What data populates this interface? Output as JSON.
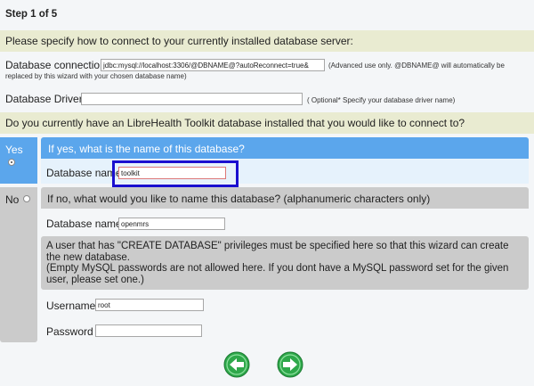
{
  "step": "Step 1 of 5",
  "intro": "Please specify how to connect to your currently installed database server:",
  "connection": {
    "label": "Database connection:",
    "value": "jdbc:mysql://localhost:3306/@DBNAME@?autoReconnect=true&",
    "note": "(Advanced use only. @DBNAME@ will automatically be replaced by this wizard with your chosen database name)"
  },
  "driver": {
    "label": "Database Driver:",
    "value": "",
    "note": "( Optional* Specify your database driver name)"
  },
  "question": "Do you currently have an LibreHealth Toolkit database installed that you would like to connect to?",
  "yes_option": {
    "label": "Yes",
    "selected": true,
    "header": "If yes, what is the name of this database?",
    "db_label": "Database name",
    "db_value": "toolkit"
  },
  "no_option": {
    "label": "No",
    "selected": false,
    "header": "If no, what would you like to name this database? (alphanumeric characters only)",
    "db_label": "Database name:",
    "db_value": "openmrs",
    "warning_1": "A user that has \"CREATE DATABASE\" privileges must be specified here so that this wizard can create the new database.",
    "warning_2": "(Empty MySQL passwords are not allowed here. If you dont have a MySQL password set for the given user, please set one.)",
    "username_label": "Username",
    "username_value": "root",
    "password_label": "Password",
    "password_value": ""
  },
  "nav": {
    "back_icon": "arrow-left-icon",
    "next_icon": "arrow-right-icon",
    "button_color": "#2ea84a"
  }
}
